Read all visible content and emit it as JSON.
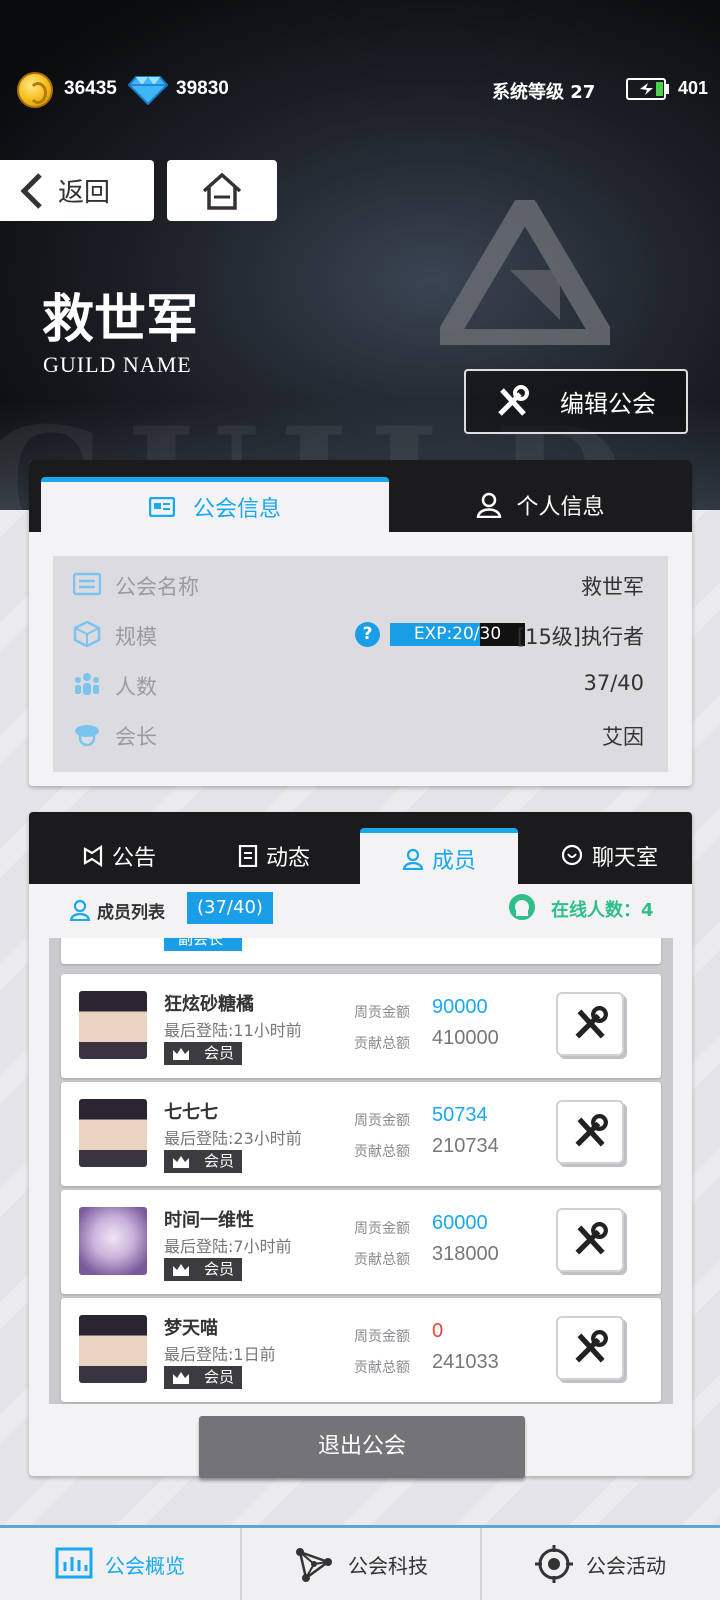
{
  "currency": {
    "coins": "36435",
    "diamonds": "39830"
  },
  "status": {
    "system_level": "系统等级 27",
    "energy": "401"
  },
  "nav": {
    "back_label": "返回"
  },
  "guild": {
    "name": "救世军",
    "subtitle": "GUILD NAME",
    "edit_label": "编辑公会"
  },
  "info_tabs": {
    "guild_info": "公会信息",
    "personal_info": "个人信息"
  },
  "info_rows": {
    "name": {
      "key": "公会名称",
      "value": "救世军"
    },
    "scale": {
      "key": "规模",
      "exp_label": "EXP:20/30",
      "exp_progress": 0.667,
      "value": "[15级]执行者"
    },
    "members": {
      "key": "人数",
      "value": "37/40"
    },
    "leader": {
      "key": "会长",
      "value": "艾因"
    }
  },
  "member_tabs": {
    "notice": "公告",
    "activity": "动态",
    "members": "成员",
    "chat": "聊天室"
  },
  "member_list": {
    "title": "成员列表",
    "count": "(37/40)",
    "online": "在线人数：4",
    "partial_role": "副会长",
    "week_label": "周贡金额",
    "total_label": "贡献总额",
    "members": [
      {
        "name": "狂炫砂糖橘",
        "last_login": "最后登陆:11小时前",
        "role": "会员",
        "week": "90000",
        "total": "410000"
      },
      {
        "name": "七七七",
        "last_login": "最后登陆:23小时前",
        "role": "会员",
        "week": "50734",
        "total": "210734"
      },
      {
        "name": "时间一维性",
        "last_login": "最后登陆:7小时前",
        "role": "会员",
        "week": "60000",
        "total": "318000"
      },
      {
        "name": "梦天喵",
        "last_login": "最后登陆:1日前",
        "role": "会员",
        "week": "0",
        "total": "241033"
      }
    ],
    "quit_label": "退出公会"
  },
  "bottom_nav": {
    "overview": "公会概览",
    "tech": "公会科技",
    "events": "公会活动"
  },
  "colors": {
    "accent": "#1aa8f0",
    "online": "#2dbf8a",
    "zero_value": "#e04a3a"
  }
}
